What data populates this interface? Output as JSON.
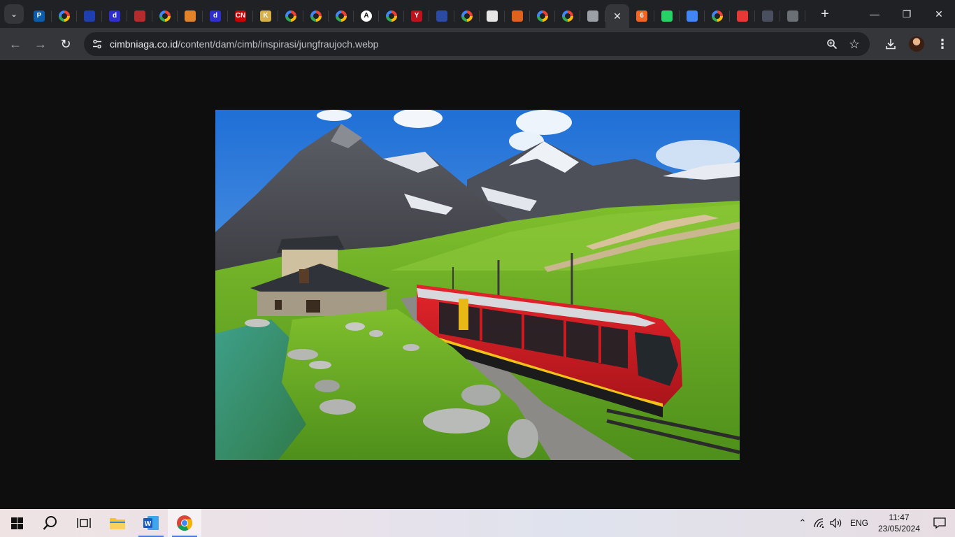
{
  "browser": {
    "tabs": [
      {
        "favicon": "p-icon",
        "label": "P",
        "color": "#0b5cad"
      },
      {
        "favicon": "google-icon"
      },
      {
        "favicon": "arrow-logo-icon",
        "color": "#1e40af"
      },
      {
        "favicon": "d-icon",
        "label": "d",
        "color": "#2f2fd0"
      },
      {
        "favicon": "red-ball-icon",
        "color": "#b52a2a"
      },
      {
        "favicon": "google-icon"
      },
      {
        "favicon": "photo-icon",
        "color": "#e2832a"
      },
      {
        "favicon": "d-icon",
        "label": "d",
        "color": "#2f2fd0"
      },
      {
        "favicon": "cnn-icon",
        "label": "CN",
        "color": "#cc0000"
      },
      {
        "favicon": "k-icon",
        "label": "K",
        "color": "#d8b04a"
      },
      {
        "favicon": "google-icon"
      },
      {
        "favicon": "google-icon"
      },
      {
        "favicon": "google-icon"
      },
      {
        "favicon": "circle-a-icon",
        "label": "A",
        "color": "#ffffff"
      },
      {
        "favicon": "google-icon"
      },
      {
        "favicon": "y-icon",
        "label": "Y",
        "color": "#c0121d"
      },
      {
        "favicon": "building-icon",
        "color": "#2b4aa3"
      },
      {
        "favicon": "google-icon"
      },
      {
        "favicon": "document-thumb-icon",
        "color": "#e6e6e6"
      },
      {
        "favicon": "nbc-peacock-icon",
        "color": "#e0611b"
      },
      {
        "favicon": "google-icon"
      },
      {
        "favicon": "google-icon"
      },
      {
        "favicon": "refresh-loop-icon",
        "color": "#9aa0a6"
      },
      {
        "favicon": "close-icon",
        "active": true
      },
      {
        "favicon": "six-icon",
        "label": "6",
        "color": "#f26522"
      },
      {
        "favicon": "whatsapp-icon",
        "color": "#25d366"
      },
      {
        "favicon": "docs-icon",
        "color": "#4285f4"
      },
      {
        "favicon": "google-icon"
      },
      {
        "favicon": "pdf-icon",
        "color": "#e53935"
      },
      {
        "favicon": "chart-icon",
        "color": "#4a4f60"
      },
      {
        "favicon": "globe-icon",
        "color": "#6b6f76"
      }
    ],
    "url": {
      "host": "cimbniaga.co.id",
      "path": "/content/dam/cimb/inspirasi/jungfraujoch.webp"
    }
  },
  "taskbar": {
    "language": "ENG",
    "time": "11:47",
    "date": "23/05/2024"
  }
}
